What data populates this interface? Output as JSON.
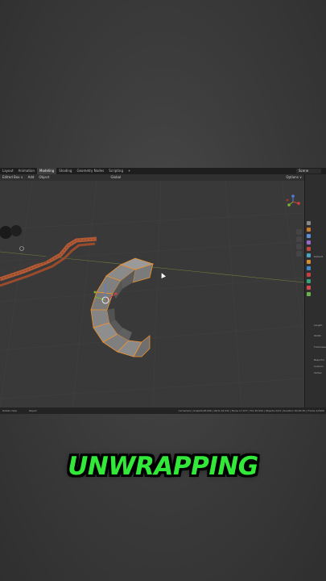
{
  "app": {
    "workspace_tabs": [
      "Layout",
      "Animation",
      "Modeling",
      "Shading",
      "Geometry Nodes",
      "Scripting",
      "+"
    ],
    "active_tab": "Modeling",
    "scene_label": "Scene",
    "header_items": [
      "Add",
      "Object"
    ],
    "header_left_mode": "Edited Box ∨",
    "header_transform": "Global",
    "header_view": "Options ∨"
  },
  "status_bar": {
    "left_items": [
      "Rotate View",
      "Object"
    ],
    "stats": "Cornerbox | ScaledCaft.006 | Verts 16,532 | Faces 17,077 | Tris 30,594 | Objects 2/24 | Duration 00:00:30 | Frame 1/2400"
  },
  "properties_panel": {
    "labels": [
      "Default",
      "Length",
      "Width",
      "Thickness",
      "Base Pol",
      "Custom",
      "Vertex"
    ]
  },
  "caption": {
    "text": "UNWRAPPING",
    "color": "#32e838"
  },
  "colors": {
    "selection_outline": "#f0922e",
    "track_brown": "#b25a36",
    "mesh_face": "#8a8a8a",
    "axis_x": "#d43f3f",
    "axis_y": "#7bb32e"
  }
}
